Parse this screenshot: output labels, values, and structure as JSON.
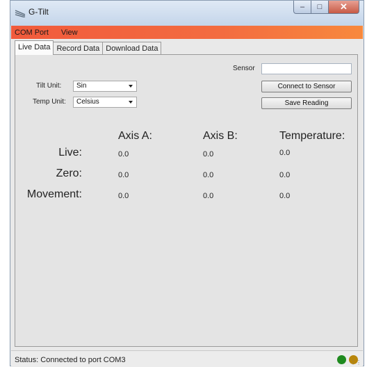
{
  "window": {
    "title": "G-Tilt",
    "icon": "app-icon"
  },
  "menu": [
    "COM Port",
    "View"
  ],
  "tabs": [
    "Live Data",
    "Record Data",
    "Download Data"
  ],
  "controls": {
    "sensor_label": "Sensor",
    "sensor_value": "",
    "tilt_unit_label": "Tilt Unit:",
    "tilt_unit_value": "Sin",
    "temp_unit_label": "Temp Unit:",
    "temp_unit_value": "Celsius",
    "connect_button": "Connect to Sensor",
    "save_button": "Save Reading"
  },
  "readings": {
    "headers": [
      "Axis A:",
      "Axis B:",
      "Temperature:"
    ],
    "rows": [
      {
        "label": "Live:",
        "values": [
          "0.0",
          "0.0",
          "0.0"
        ]
      },
      {
        "label": "Zero:",
        "values": [
          "0.0",
          "0.0",
          "0.0"
        ]
      },
      {
        "label": "Movement:",
        "values": [
          "0.0",
          "0.0",
          "0.0"
        ]
      }
    ]
  },
  "status": {
    "text": "Status: Connected to port COM3",
    "indicators": [
      {
        "name": "green-led",
        "color": "#1f8a1f"
      },
      {
        "name": "amber-led",
        "color": "#b8860b"
      }
    ]
  },
  "colors": {
    "menubar": "#f36c40"
  }
}
